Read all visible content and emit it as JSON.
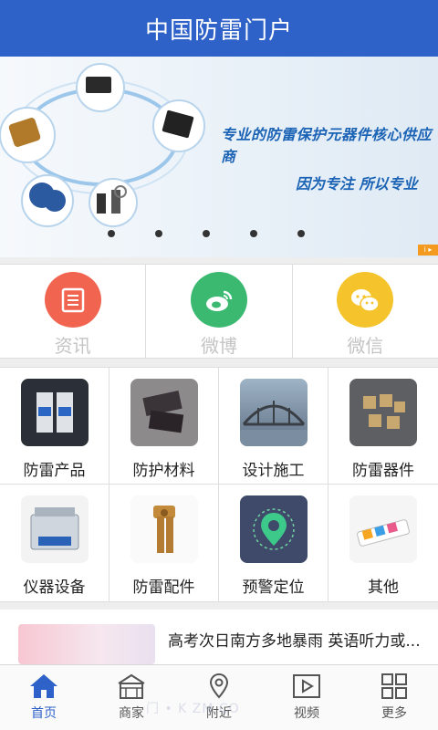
{
  "header": {
    "title": "中国防雷门户"
  },
  "banner": {
    "slogan_main": "专业的防雷保护元器件核心供应商",
    "slogan_sub": "因为专注 所以专业",
    "dot_count": 5,
    "active_dot": 0
  },
  "quick_links": [
    {
      "label": "资讯",
      "icon": "news-icon",
      "color": "#f06450"
    },
    {
      "label": "微博",
      "icon": "weibo-icon",
      "color": "#3cb971"
    },
    {
      "label": "微信",
      "icon": "wechat-icon",
      "color": "#f5c42c"
    }
  ],
  "categories": [
    {
      "label": "防雷产品",
      "image": "surge-protector-image"
    },
    {
      "label": "防护材料",
      "image": "protective-material-image"
    },
    {
      "label": "设计施工",
      "image": "bridge-construction-image"
    },
    {
      "label": "防雷器件",
      "image": "lightning-components-image"
    },
    {
      "label": "仪器设备",
      "image": "ultrasonic-cleaner-image"
    },
    {
      "label": "防雷配件",
      "image": "ground-clamp-image"
    },
    {
      "label": "预警定位",
      "image": "location-pin-image"
    },
    {
      "label": "其他",
      "image": "power-strip-image"
    }
  ],
  "news": {
    "title": "高考次日南方多地暴雨 英语听力或..."
  },
  "tabs": [
    {
      "label": "首页",
      "icon": "home-icon",
      "active": true
    },
    {
      "label": "商家",
      "icon": "store-icon",
      "active": false
    },
    {
      "label": "附近",
      "icon": "location-icon",
      "active": false
    },
    {
      "label": "视频",
      "icon": "video-icon",
      "active": false
    },
    {
      "label": "更多",
      "icon": "more-grid-icon",
      "active": false
    }
  ],
  "watermark": "门 • K  ZM.CO",
  "colors": {
    "header": "#2f62c8",
    "active_tab": "#2f62c8"
  }
}
